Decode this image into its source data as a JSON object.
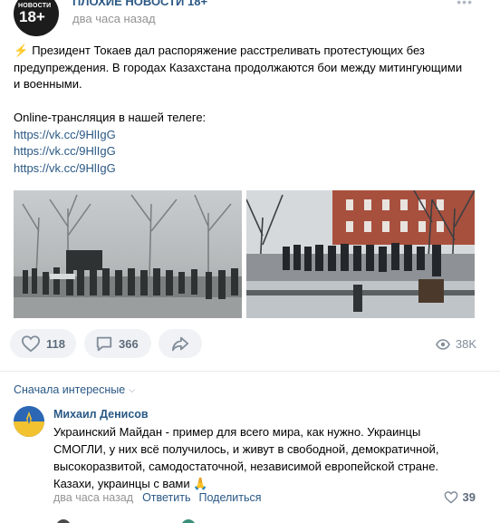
{
  "post": {
    "group_name": "ПЛОХИЕ НОВОСТИ 18+",
    "time": "два часа назад",
    "avatar_text_top": "НОВОСТИ",
    "avatar_text_big": "18+",
    "text_lines": [
      "Президент Токаев дал распоряжение расстреливать протестующих без",
      "предупреждения. В городах Казахстана продолжаются бои между митингующими",
      "и военными."
    ],
    "telegram_line": "Online-трансляция в нашей телеге:",
    "links": [
      "https://vk.cc/9HlIgG",
      "https://vk.cc/9HlIgG",
      "https://vk.cc/9HlIgG"
    ],
    "photos": [
      {
        "icon": "photo-riot-police-fog"
      },
      {
        "icon": "photo-soldiers-street"
      }
    ]
  },
  "actions": {
    "likes": "118",
    "comments": "366",
    "views": "38K"
  },
  "comments_section": {
    "sort_label": "Сначала интересные"
  },
  "comment": {
    "author": "Михаил Денисов",
    "text_lines": [
      "Украинский Майдан - пример для всего мира, как нужно. Украинцы",
      "СМОГЛИ, у них всё получилось, и живут в свободной, демократичной,",
      "высокоразвитой, самодостаточной, независимой европейской стране.",
      "Казахи, украинцы с вами 🙏"
    ],
    "time": "два часа назад",
    "reply_label": "Ответить",
    "share_label": "Поделиться",
    "likes": "39"
  },
  "colors": {
    "link": "#2a5885",
    "muted": "#939393",
    "button_bg": "#f0f2f5"
  }
}
